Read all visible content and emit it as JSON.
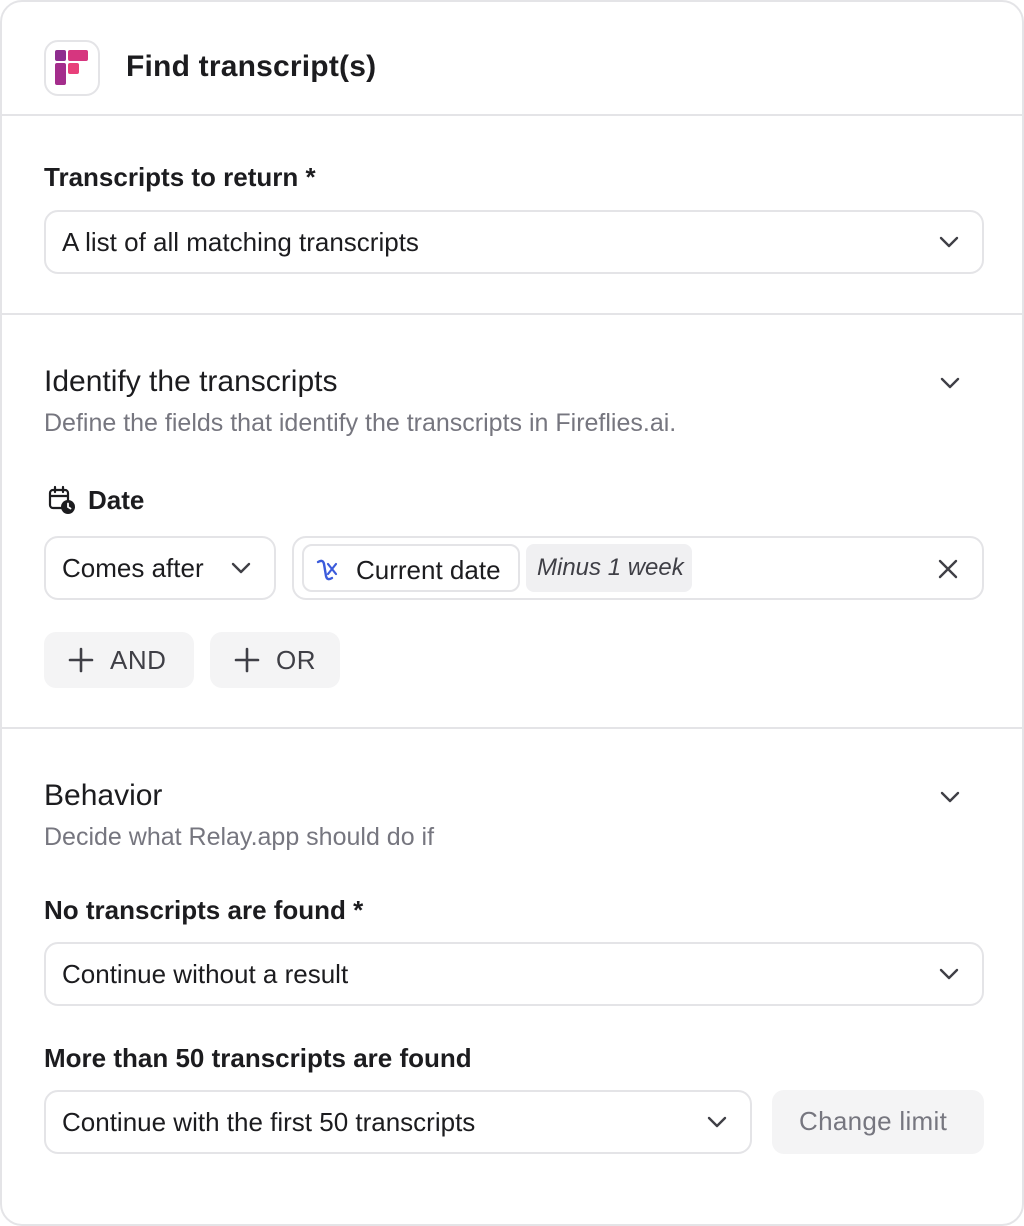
{
  "header": {
    "title": "Find transcript(s)",
    "app_icon": "fireflies-logo"
  },
  "return_section": {
    "label": "Transcripts to return *",
    "selected": "A list of all matching transcripts"
  },
  "identify_section": {
    "title": "Identify the transcripts",
    "subtitle": "Define the fields that identify the transcripts in Fireflies.ai.",
    "field_label": "Date",
    "field_icon": "calendar-clock-icon",
    "operator": "Comes after",
    "value_pill": "Current date",
    "value_modifier": "Minus 1 week",
    "and_button": "AND",
    "or_button": "OR"
  },
  "behavior_section": {
    "title": "Behavior",
    "subtitle": "Decide what Relay.app should do if",
    "none_label": "No transcripts are found *",
    "none_value": "Continue without a result",
    "many_label": "More than 50 transcripts are found",
    "many_value": "Continue with the first 50 transcripts",
    "change_limit": "Change limit"
  },
  "colors": {
    "brand_pink": "#d6367f",
    "brand_purple": "#7b2a8e",
    "variable_blue": "#3b5bdb"
  }
}
